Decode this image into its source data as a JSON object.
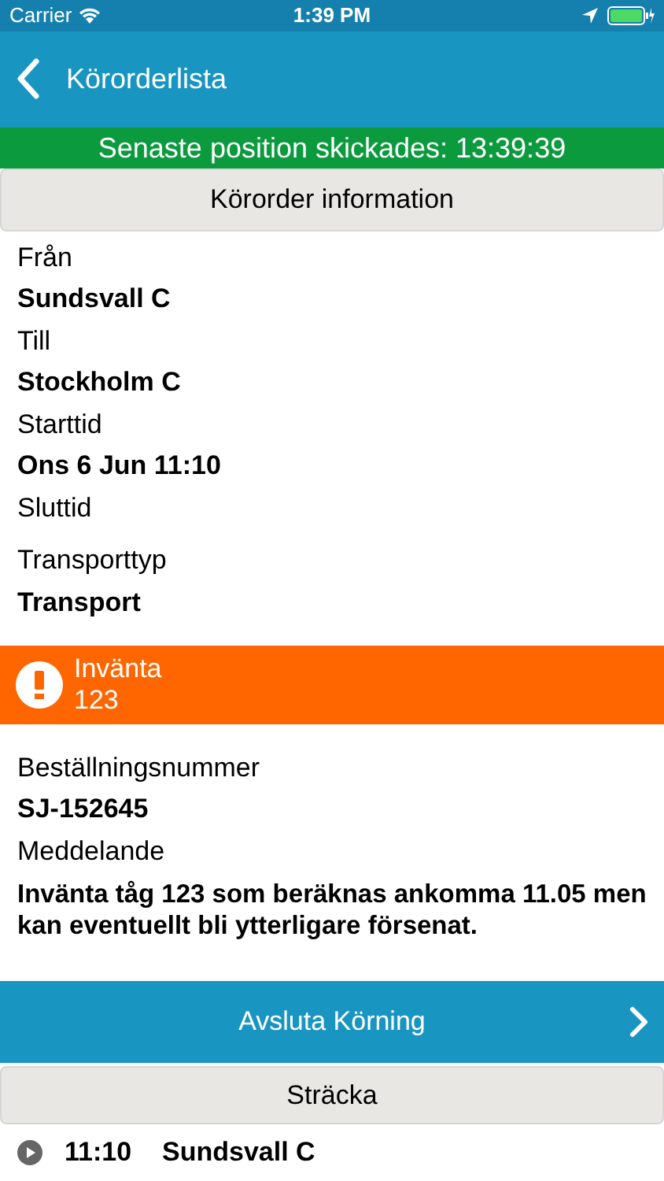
{
  "status_bar": {
    "carrier": "Carrier",
    "time": "1:39 PM"
  },
  "nav": {
    "back_label": "Körorderlista"
  },
  "position_banner": "Senaste position skickades: 13:39:39",
  "info_header": "Körorder information",
  "fields": [
    {
      "label": "Från",
      "value": "Sundsvall C"
    },
    {
      "label": "Till",
      "value": "Stockholm C"
    },
    {
      "label": "Starttid",
      "value": "Ons 6 Jun 11:10"
    },
    {
      "label": "Sluttid"
    },
    {
      "label": "Transporttyp",
      "value": "Transport"
    }
  ],
  "alert": {
    "title": "Invänta",
    "subtitle": "123"
  },
  "order_fields": [
    {
      "label": "Beställningsnummer",
      "value": "SJ-152645"
    },
    {
      "label": "Meddelande",
      "value": "Invänta tåg 123 som beräknas ankomma 11.05 men kan eventuellt bli ytterligare försenat."
    }
  ],
  "action_button": "Avsluta Körning",
  "route_header": "Sträcka",
  "route": [
    {
      "time": "11:10",
      "station": "Sundsvall C"
    }
  ]
}
